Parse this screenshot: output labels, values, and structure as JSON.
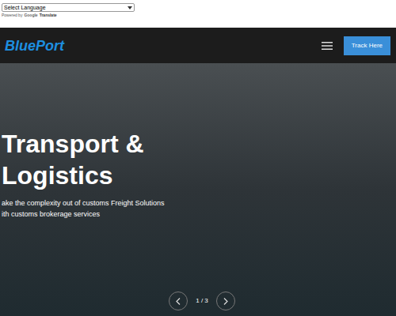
{
  "translate": {
    "select": "Select Language",
    "powered": "Powered by",
    "google": "Google",
    "translate": "Translate"
  },
  "header": {
    "logo": "BluePort",
    "button": "Track Here"
  },
  "hero": {
    "title_lines": [
      "Transport &",
      "Logistics"
    ],
    "subtitle_lines": [
      "ake the complexity out of customs Freight Solutions",
      "ith customs brokerage services"
    ]
  },
  "slider": {
    "counter": "1 / 3"
  }
}
